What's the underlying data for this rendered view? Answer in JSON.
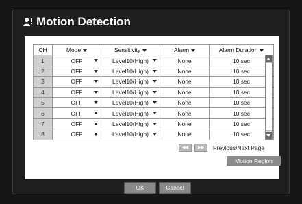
{
  "window": {
    "title": "Motion Detection"
  },
  "table": {
    "columns": [
      "CH",
      "Mode",
      "Sensitivity",
      "Alarm",
      "Alarm Duration"
    ],
    "rows": [
      {
        "ch": "1",
        "mode": "OFF",
        "sensitivity": "Level10(High)",
        "alarm": "None",
        "duration": "10 sec"
      },
      {
        "ch": "2",
        "mode": "OFF",
        "sensitivity": "Level10(High)",
        "alarm": "None",
        "duration": "10 sec"
      },
      {
        "ch": "3",
        "mode": "OFF",
        "sensitivity": "Level10(High)",
        "alarm": "None",
        "duration": "10 sec"
      },
      {
        "ch": "4",
        "mode": "OFF",
        "sensitivity": "Level10(High)",
        "alarm": "None",
        "duration": "10 sec"
      },
      {
        "ch": "5",
        "mode": "OFF",
        "sensitivity": "Level10(High)",
        "alarm": "None",
        "duration": "10 sec"
      },
      {
        "ch": "6",
        "mode": "OFF",
        "sensitivity": "Level10(High)",
        "alarm": "None",
        "duration": "10 sec"
      },
      {
        "ch": "7",
        "mode": "OFF",
        "sensitivity": "Level10(High)",
        "alarm": "None",
        "duration": "10 sec"
      },
      {
        "ch": "8",
        "mode": "OFF",
        "sensitivity": "Level10(High)",
        "alarm": "None",
        "duration": "10 sec"
      }
    ]
  },
  "pager": {
    "prev_icon": "rewind-icon",
    "next_icon": "fast-forward-icon",
    "label": "Previous/Next Page"
  },
  "buttons": {
    "motion_region": "Motion Region",
    "ok": "OK",
    "cancel": "Cancel"
  },
  "icons": {
    "title": "user-icon"
  },
  "colors": {
    "background": "#151515",
    "panel": "#ffffff",
    "ch_cell": "#cfcfcf",
    "button": "#8a8a8a"
  }
}
